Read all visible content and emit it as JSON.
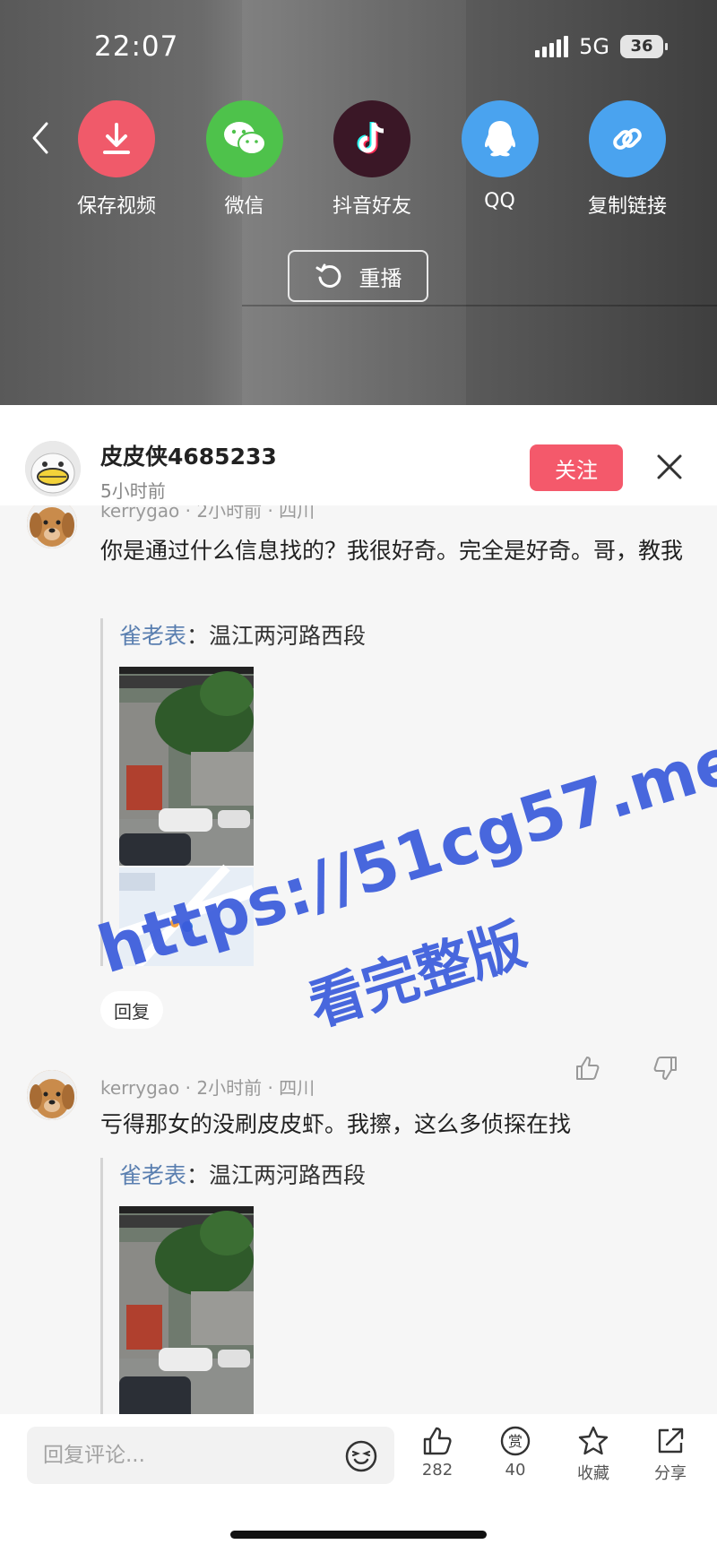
{
  "status": {
    "time": "22:07",
    "network": "5G",
    "battery": "36"
  },
  "share": {
    "items": [
      {
        "label": "保存视频",
        "icon": "download-icon"
      },
      {
        "label": "微信",
        "icon": "wechat-icon"
      },
      {
        "label": "抖音好友",
        "icon": "douyin-icon"
      },
      {
        "label": "QQ",
        "icon": "qq-icon"
      },
      {
        "label": "复制链接",
        "icon": "link-icon"
      }
    ],
    "replay_label": "重播"
  },
  "author": {
    "name": "皮皮侠4685233",
    "time": "5小时前",
    "follow_label": "关注"
  },
  "comments": [
    {
      "user": "kerrygao",
      "meta": "kerrygao · 2小时前 · 四川",
      "text": "你是通过什么信息找的？我很好奇。完全是好奇。哥，教我",
      "quote_user": "雀老表",
      "quote_text": "：温江两河路西段",
      "reply_label": "回复"
    },
    {
      "user": "kerrygao",
      "meta": "kerrygao · 2小时前 · 四川",
      "text": "亏得那女的没刷皮皮虾。我擦，这么多侦探在找",
      "quote_user": "雀老表",
      "quote_text": "：温江两河路西段"
    }
  ],
  "watermark": {
    "line1": "https://51cg57.me",
    "line2": "看完整版"
  },
  "bottom": {
    "reply_placeholder": "回复评论...",
    "like_count": "282",
    "reward_count": "40",
    "reward_glyph": "赏",
    "favorite_label": "收藏",
    "share_label": "分享"
  },
  "colors": {
    "follow": "#f4596b",
    "quote_user": "#5a7fb0",
    "watermark": "#3a5bdb"
  }
}
